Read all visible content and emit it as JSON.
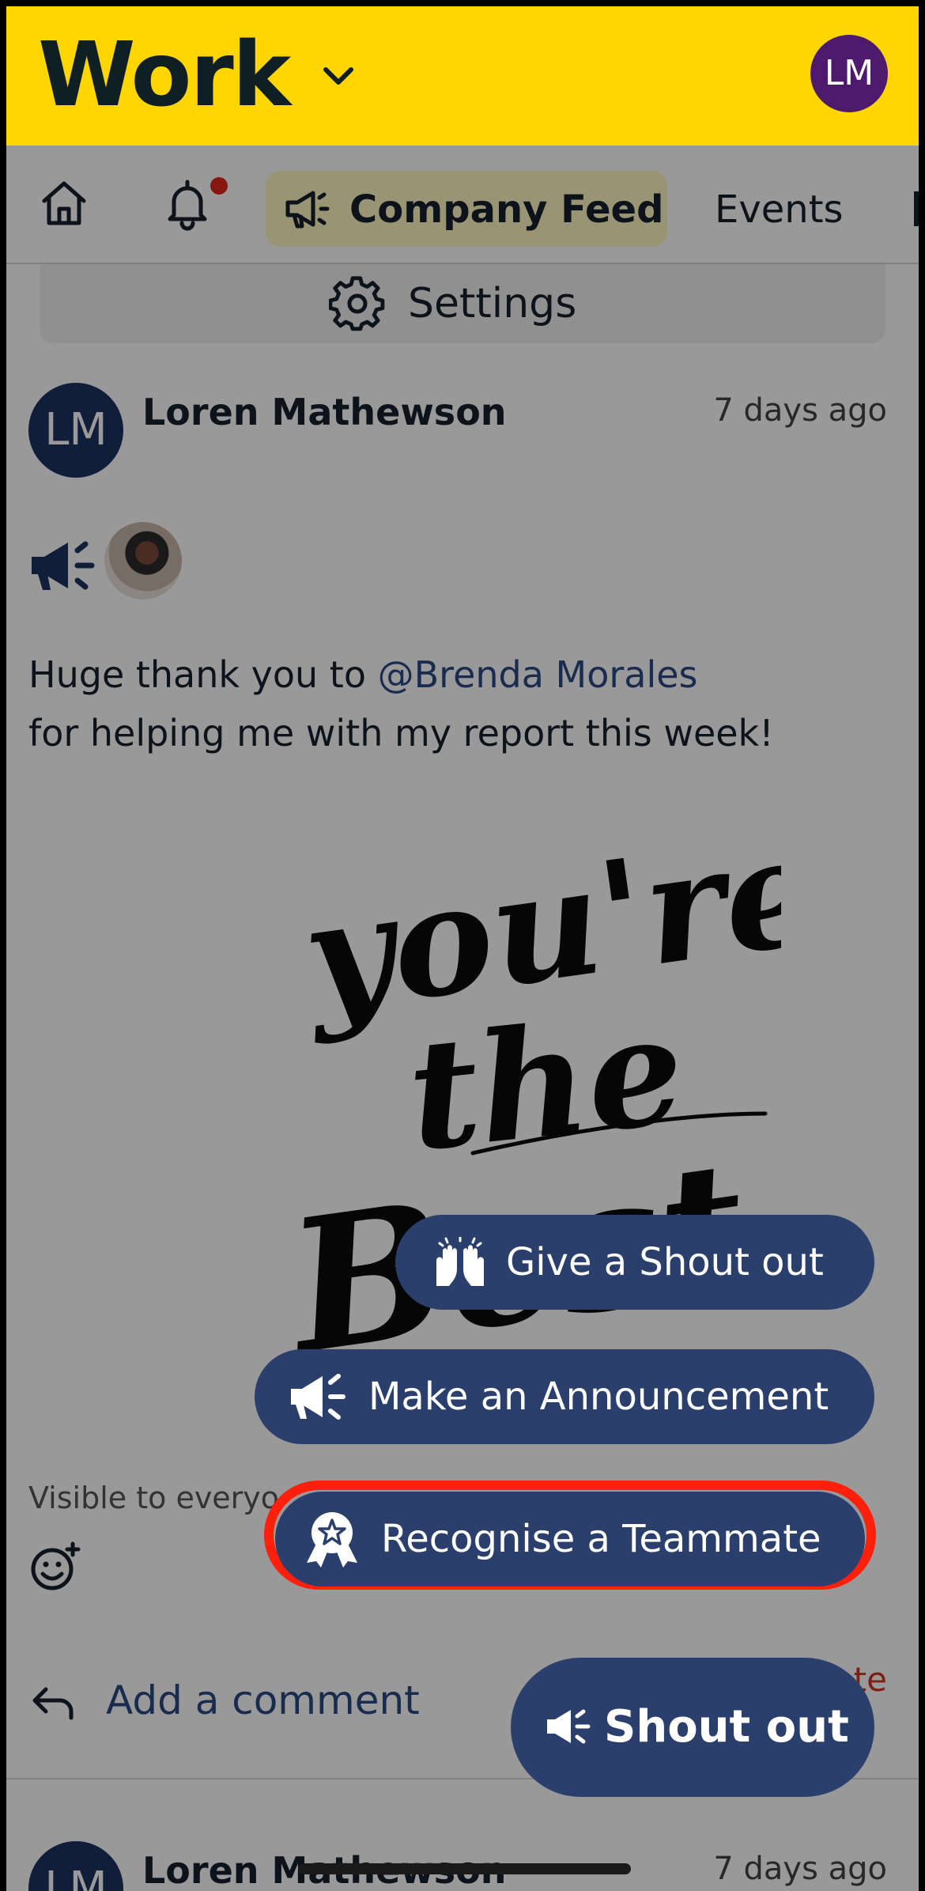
{
  "app": {
    "logo_text": "Work",
    "user_initials": "LM"
  },
  "tabs": {
    "home_icon": "home-icon",
    "notifications_icon": "bell-icon",
    "company_feed_label": "Company Feed",
    "events_label": "Events"
  },
  "settings": {
    "label": "Settings"
  },
  "post": {
    "author_initials": "LM",
    "author": "Loren Mathewson",
    "time": "7 days ago",
    "text_before": "Huge thank you to ",
    "mention": "@Brenda Morales",
    "text_after": " for helping me with my report this week!",
    "image_line1": "you're",
    "image_line2": "the",
    "image_line3": "Best",
    "visibility": "Visible to everyo",
    "add_comment": "Add a comment",
    "delete_partial": "ete"
  },
  "post2": {
    "author_initials": "LM",
    "author": "Loren Mathewson",
    "time": "7 days ago"
  },
  "fab_menu": {
    "give_shout_out": "Give a Shout out",
    "make_announcement": "Make an Announcement",
    "recognise_teammate": "Recognise a Teammate",
    "main_button": "Shout out"
  },
  "colors": {
    "header_bg": "#ffd600",
    "fab_bg": "#2a3f6b",
    "highlight_ring": "#ff1f0a",
    "notification_dot": "#e0281b",
    "avatar_top": "#4e1a6e"
  }
}
